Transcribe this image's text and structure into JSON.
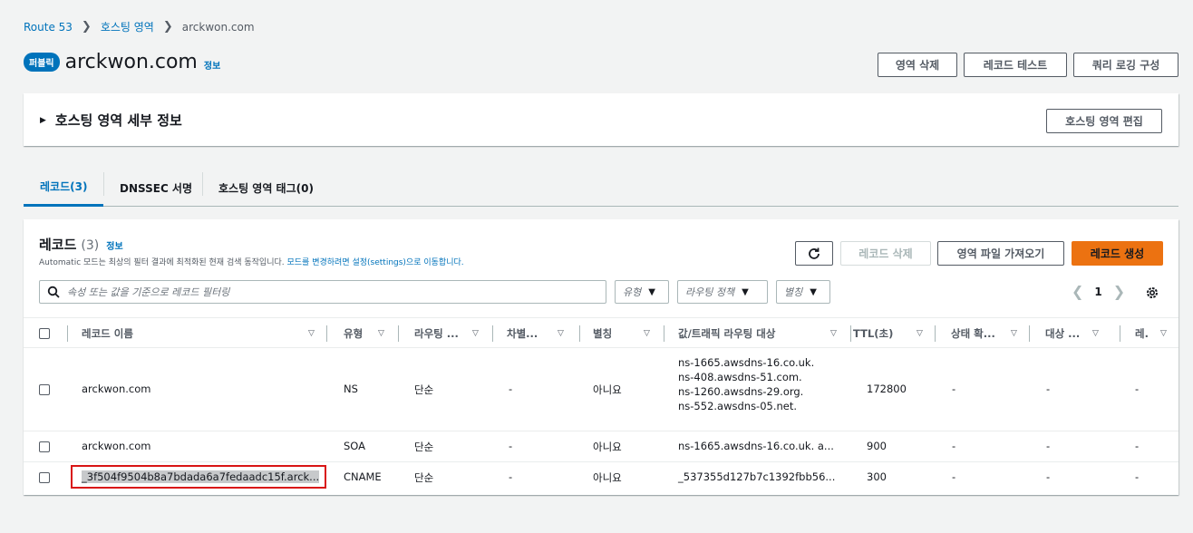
{
  "breadcrumb": {
    "items": [
      "Route 53",
      "호스팅 영역"
    ],
    "current": "arckwon.com"
  },
  "header": {
    "badge": "퍼블릭",
    "title": "arckwon.com",
    "info": "정보"
  },
  "actions": {
    "delete_zone": "영역 삭제",
    "test_record": "레코드 테스트",
    "query_logging": "쿼리 로깅 구성"
  },
  "details": {
    "title": "호스팅 영역 세부 정보",
    "edit_button": "호스팅 영역 편집"
  },
  "tabs": [
    {
      "label": "레코드(3)",
      "active": true
    },
    {
      "label": "DNSSEC 서명",
      "active": false
    },
    {
      "label": "호스팅 영역 태그(0)",
      "active": false
    }
  ],
  "records": {
    "title": "레코드",
    "count": "(3)",
    "info": "정보",
    "subtitle_prefix": "Automatic 모드는 최상의 필터 결과에 최적화된 현재 검색 동작입니다.",
    "subtitle_link": "모드를 변경하려면 설정(settings)으로 이동합니다.",
    "refresh_icon": "refresh-icon",
    "delete_button": "레코드 삭제",
    "import_button": "영역 파일 가져오기",
    "create_button": "레코드 생성",
    "search_placeholder": "속성 또는 값을 기준으로 레코드 필터링",
    "filters": [
      "유형",
      "라우팅 정책",
      "별칭"
    ],
    "page": "1",
    "columns": [
      "레코드 이름",
      "유형",
      "라우팅 ...",
      "차별...",
      "별칭",
      "값/트래픽 라우팅 대상",
      "TTL(초)",
      "상태 확...",
      "대상 ...",
      "레."
    ],
    "rows": [
      {
        "name": "arckwon.com",
        "type": "NS",
        "routing": "단순",
        "diff": "-",
        "alias": "아니요",
        "values": [
          "ns-1665.awsdns-16.co.uk.",
          "ns-408.awsdns-51.com.",
          "ns-1260.awsdns-29.org.",
          "ns-552.awsdns-05.net."
        ],
        "ttl": "172800",
        "health": "-",
        "target": "-",
        "record_id": "-"
      },
      {
        "name": "arckwon.com",
        "type": "SOA",
        "routing": "단순",
        "diff": "-",
        "alias": "아니요",
        "values": [
          "ns-1665.awsdns-16.co.uk. a..."
        ],
        "ttl": "900",
        "health": "-",
        "target": "-",
        "record_id": "-"
      },
      {
        "name": "_3f504f9504b8a7bdada6a7fedaadc15f.arck...",
        "type": "CNAME",
        "routing": "단순",
        "diff": "-",
        "alias": "아니요",
        "values": [
          "_537355d127b7c1392fbb56..."
        ],
        "ttl": "300",
        "health": "-",
        "target": "-",
        "record_id": "-"
      }
    ]
  },
  "colors": {
    "accent": "#0073bb",
    "primary": "#ec7211",
    "highlight": "#d91515"
  }
}
